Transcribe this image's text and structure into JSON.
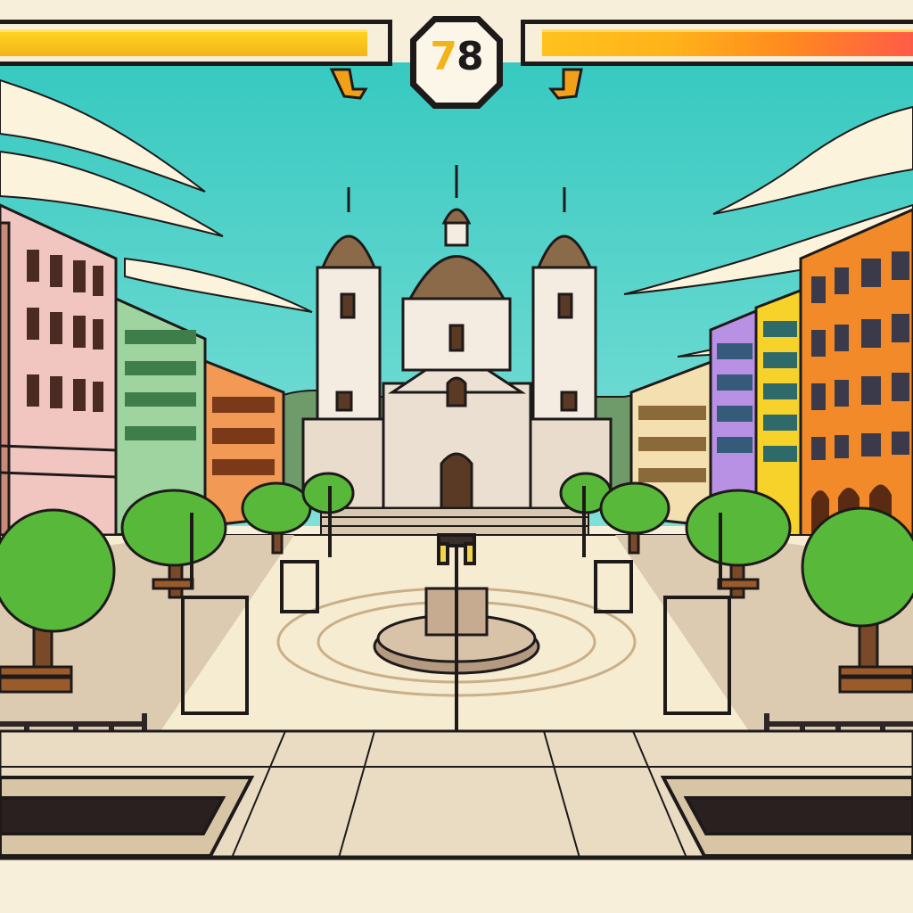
{
  "hud": {
    "timer": "78",
    "player1_health": 0.97,
    "player2_health": 0.98
  },
  "colors": {
    "sky": "#3fd0c4",
    "health_bar_p1": "#ffd321",
    "health_bar_p2_end": "#ff5a4a",
    "outline": "#1e1a1a",
    "plaza_floor": "#f5ecd2",
    "foliage": "#58b83a"
  },
  "scene": {
    "setting": "city-plaza-stage",
    "landmark": "cathedral",
    "props": [
      "fountain",
      "street-lamps",
      "trees",
      "benches",
      "railings"
    ]
  }
}
